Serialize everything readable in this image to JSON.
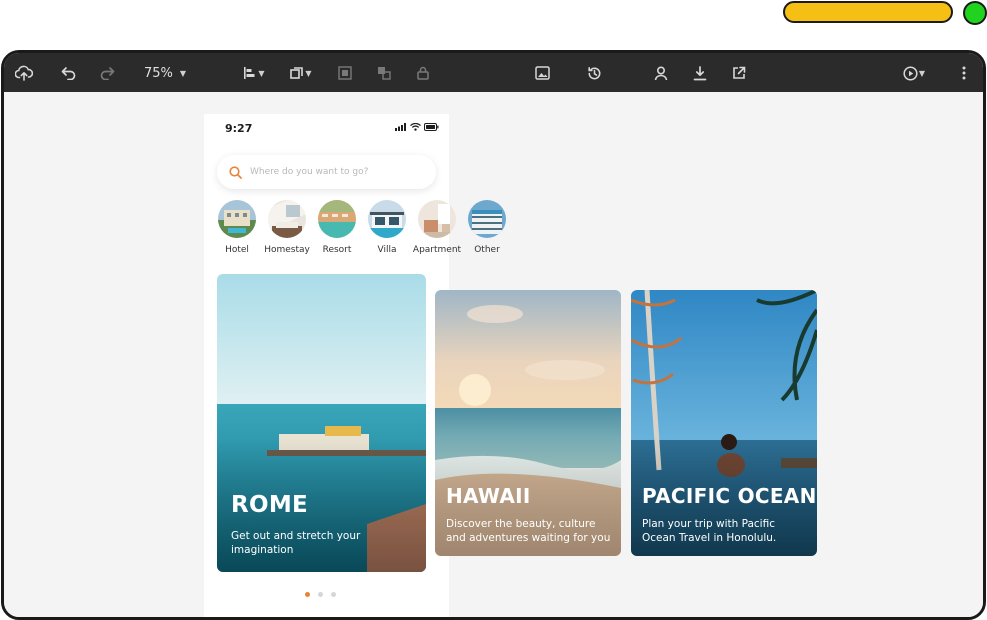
{
  "toolbar": {
    "zoom": "75%",
    "icons": [
      "upload-cloud-icon",
      "undo-icon",
      "redo-icon",
      "align-icon",
      "arrange-icon",
      "group-icon",
      "ungroup-icon",
      "lock-icon",
      "image-icon",
      "history-icon",
      "user-icon",
      "download-icon",
      "share-icon",
      "play-icon",
      "more-icon"
    ]
  },
  "phone": {
    "time": "9:27",
    "search_placeholder": "Where do you want to go?",
    "categories": [
      {
        "label": "Hotel"
      },
      {
        "label": "Homestay"
      },
      {
        "label": "Resort"
      },
      {
        "label": "Villa"
      },
      {
        "label": "Apartment"
      },
      {
        "label": "Other"
      }
    ],
    "pager": {
      "total": 3,
      "active": 1
    }
  },
  "cards": [
    {
      "title": "ROME",
      "subtitle": "Get out and stretch your imagination"
    },
    {
      "title": "HAWAII",
      "subtitle": "Discover the beauty, culture and adventures waiting for you"
    },
    {
      "title": "PACIFIC OCEAN",
      "subtitle": "Plan your trip with Pacific Ocean Travel in Honolulu."
    }
  ],
  "colors": {
    "toolbar_bg": "#2b2b2b",
    "canvas_bg": "#f4f4f4",
    "accent": "#e8833a",
    "pill": "#f6bf13",
    "status_dot": "#1fd31f"
  }
}
